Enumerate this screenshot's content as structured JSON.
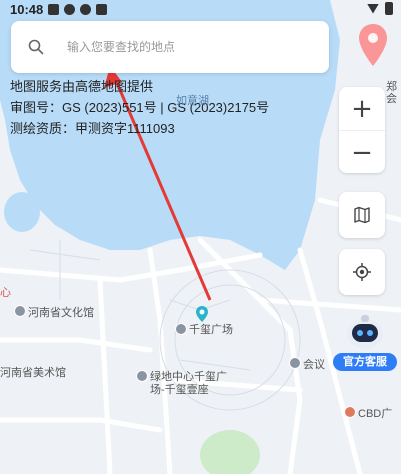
{
  "status_bar": {
    "time": "10:48"
  },
  "search": {
    "placeholder": "输入您要查找的地点"
  },
  "credits": {
    "line1": "地图服务由高德地图提供",
    "line2": "审图号：GS (2023)551号 | GS (2023)2175号",
    "line3": "测绘资质：甲测资字1111093"
  },
  "map_labels": {
    "lake": "如意湖",
    "museum": "河南省文化馆",
    "art": "河南省美术馆",
    "plaza": "千玺广场",
    "greenland_1": "绿地中心千玺广",
    "greenland_2": "场-千玺壹座",
    "convention": "会议",
    "cbd": "CBD广",
    "zheng": "郑",
    "zheng2": "会",
    "left_edge": "心"
  },
  "controls": {
    "zoom_in": "+",
    "zoom_out": "−"
  },
  "service": {
    "label": "官方客服"
  },
  "colors": {
    "water": "#b8dcf8",
    "accent": "#2f7df6",
    "arrow": "#e53935",
    "pin": "#27b5c9"
  }
}
